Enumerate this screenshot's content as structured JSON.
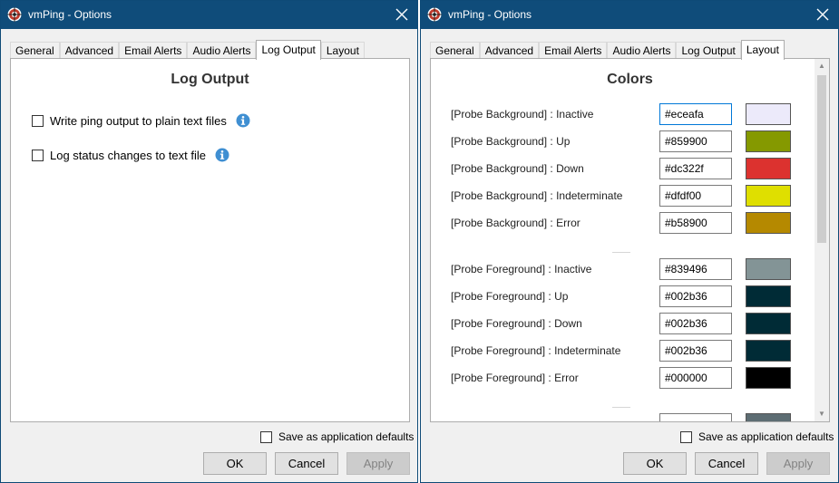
{
  "window1": {
    "title": "vmPing - Options",
    "tabs": [
      "General",
      "Advanced",
      "Email Alerts",
      "Audio Alerts",
      "Log Output",
      "Layout"
    ],
    "active_tab": "Log Output",
    "heading": "Log Output",
    "options": [
      {
        "label": "Write ping output to plain text files",
        "checked": false
      },
      {
        "label": "Log status changes to text file",
        "checked": false
      }
    ],
    "save_defaults_label": "Save as application defaults",
    "ok_label": "OK",
    "cancel_label": "Cancel",
    "apply_label": "Apply"
  },
  "window2": {
    "title": "vmPing - Options",
    "tabs": [
      "General",
      "Advanced",
      "Email Alerts",
      "Audio Alerts",
      "Log Output",
      "Layout"
    ],
    "active_tab": "Layout",
    "heading": "Colors",
    "background_colors": [
      {
        "label": "[Probe Background] : Inactive",
        "value": "#eceafa"
      },
      {
        "label": "[Probe Background] : Up",
        "value": "#859900"
      },
      {
        "label": "[Probe Background] : Down",
        "value": "#dc322f"
      },
      {
        "label": "[Probe Background] : Indeterminate",
        "value": "#dfdf00"
      },
      {
        "label": "[Probe Background] : Error",
        "value": "#b58900"
      }
    ],
    "foreground_colors": [
      {
        "label": "[Probe Foreground] : Inactive",
        "value": "#839496"
      },
      {
        "label": "[Probe Foreground] : Up",
        "value": "#002b36"
      },
      {
        "label": "[Probe Foreground] : Down",
        "value": "#002b36"
      },
      {
        "label": "[Probe Foreground] : Indeterminate",
        "value": "#002b36"
      },
      {
        "label": "[Probe Foreground] : Error",
        "value": "#000000"
      }
    ],
    "save_defaults_label": "Save as application defaults",
    "ok_label": "OK",
    "cancel_label": "Cancel",
    "apply_label": "Apply"
  },
  "icons": {
    "app": "vmping-logo-icon",
    "close": "close-icon",
    "info": "info-icon"
  },
  "colors": {
    "titlebar": "#0f4c7a",
    "info": "#3f8fd2",
    "focus": "#0078d7"
  }
}
